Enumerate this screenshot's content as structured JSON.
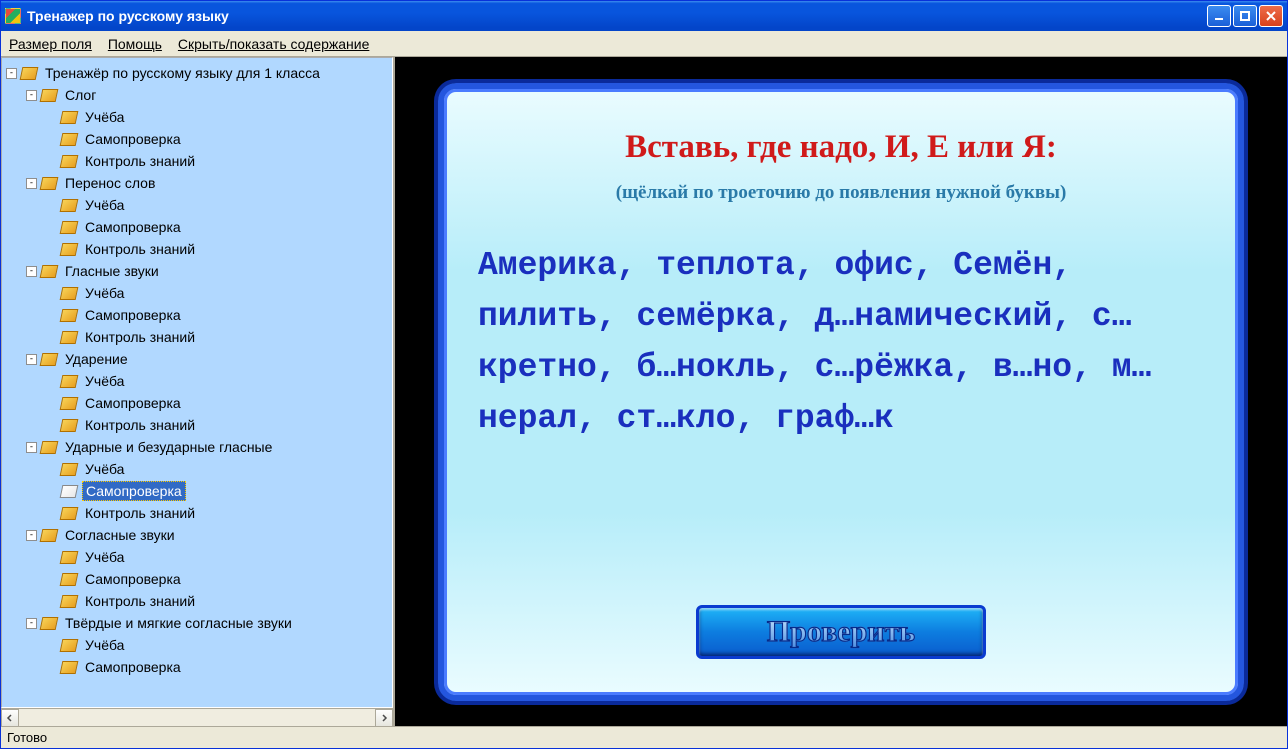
{
  "window": {
    "title": "Тренажер по русскому языку"
  },
  "menu": {
    "field_size": "Размер поля",
    "help": "Помощь",
    "toggle_contents": "Скрыть/показать содержание"
  },
  "tree": {
    "root": "Тренажёр по русскому языку для 1 класса",
    "topics": [
      "Слог",
      "Перенос слов",
      "Гласные звуки",
      "Ударение",
      "Ударные и безударные гласные",
      "Согласные звуки",
      "Твёрдые и мягкие согласные звуки"
    ],
    "sub": {
      "study": "Учёба",
      "selfcheck": "Самопроверка",
      "test": "Контроль знаний"
    },
    "selected_topic_index": 4,
    "selected_sub": "selfcheck"
  },
  "card": {
    "title": "Вставь, где надо, И, Е или Я:",
    "subtitle": "(щёлкай по троеточию до появления нужной буквы)",
    "body": "Америка, теплота, офис, Семён, пилить, семёрка, д…намический, с…кретно, б…нокль, с…рёжка, в…но, м…нерал, ст…кло, граф…к",
    "check_button": "Проверить"
  },
  "status": {
    "text": "Готово"
  }
}
